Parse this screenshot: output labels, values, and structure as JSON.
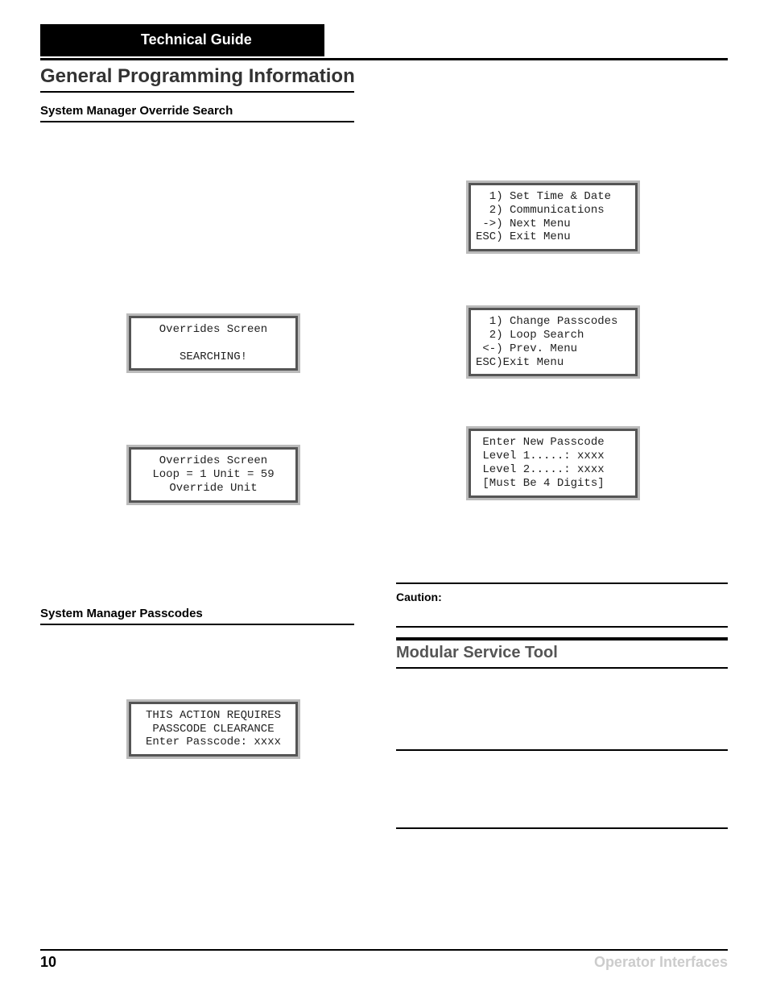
{
  "header": {
    "title": "Technical Guide"
  },
  "page_title": "General Programming Information",
  "left": {
    "sub1": "System Manager Override Search",
    "lcd1": "Overrides Screen\n\nSEARCHING!",
    "lcd2": "Overrides Screen\nLoop = 1  Unit = 59\nOverride Unit",
    "sub2": "System Manager Passcodes",
    "lcd3": "THIS ACTION REQUIRES\n PASSCODE CLEARANCE\nEnter Passcode: xxxx"
  },
  "right": {
    "lcd1": "  1) Set Time & Date\n  2) Communications\n ->) Next Menu\nESC) Exit Menu",
    "lcd2": "  1) Change Passcodes\n  2) Loop Search\n <-) Prev. Menu\nESC)Exit Menu",
    "lcd3": " Enter New Passcode\n Level 1.....: xxxx\n Level 2.....: xxxx\n [Must Be 4 Digits]",
    "caution_label": "Caution:",
    "mst_heading": "Modular Service Tool"
  },
  "footer": {
    "page": "10",
    "right": "Operator Interfaces"
  }
}
